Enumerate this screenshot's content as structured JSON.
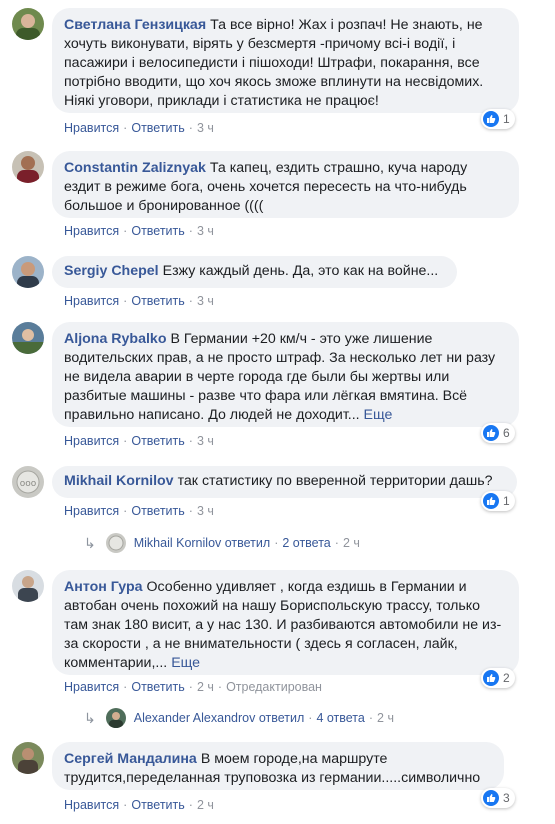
{
  "labels": {
    "like": "Нравится",
    "reply": "Ответить",
    "more": "Еще"
  },
  "comments": [
    {
      "author": "Светлана Гензицкая",
      "text": "Та все вірно! Жах і розпач! Не знають, не хочуть виконувати, вірять у безсмертя -причому всі-і водії, і пасажири і велосипедисти і пішоходи! Штрафи, покарання, все потрібно вводити, що хоч якось зможе вплинути на несвідомих. Ніякі уговори, приклади і статистика не працює!",
      "time": "3 ч",
      "reactions": "1"
    },
    {
      "author": "Constantin Zaliznyak",
      "text": "Та капец, ездить страшно, куча народу ездит в режиме бога, очень хочется пересесть на что-нибудь большое и бронированное ((((",
      "time": "3 ч"
    },
    {
      "author": "Sergiy Chepel",
      "text": "Езжу каждый день. Да, это как на войне...",
      "time": "3 ч"
    },
    {
      "author": "Aljona Rybalko",
      "text": "В Германии +20 км/ч - это уже лишение водительских прав, а не просто штраф. За несколько лет ни разу не видела аварии в черте города где были бы жертвы или разбитые машины - разве что фара или лёгкая вмятина. Всё правильно написано. До людей не доходит...",
      "time": "3 ч",
      "reactions": "6"
    },
    {
      "author": "Mikhail Kornilov",
      "text": "так статистику по вверенной территории дашь?",
      "time": "3 ч",
      "reactions": "1",
      "reply": {
        "text": "Mikhail Kornilov ответил",
        "count": "2 ответа",
        "time": "2 ч"
      }
    },
    {
      "author": "Антон Гура",
      "text": "Особенно удивляет , когда ездишь в Германии и автобан очень похожий на нашу Бориспольскую трассу, только там знак 180 висит, а у нас 130. И разбиваются автомобили не из-за скорости , а не внимательности ( здесь я согласен, лайк, комментарии,...",
      "time": "2 ч",
      "edited": "Отредактирован",
      "reactions": "2",
      "reply": {
        "text": "Alexander Alexandrov ответил",
        "count": "4 ответа",
        "time": "2 ч"
      }
    },
    {
      "author": "Сергей Мандалина",
      "text": "В моем городе,на маршруте трудится,переделанная труповозка из германии.....символично",
      "time": "2 ч",
      "reactions": "3"
    }
  ]
}
